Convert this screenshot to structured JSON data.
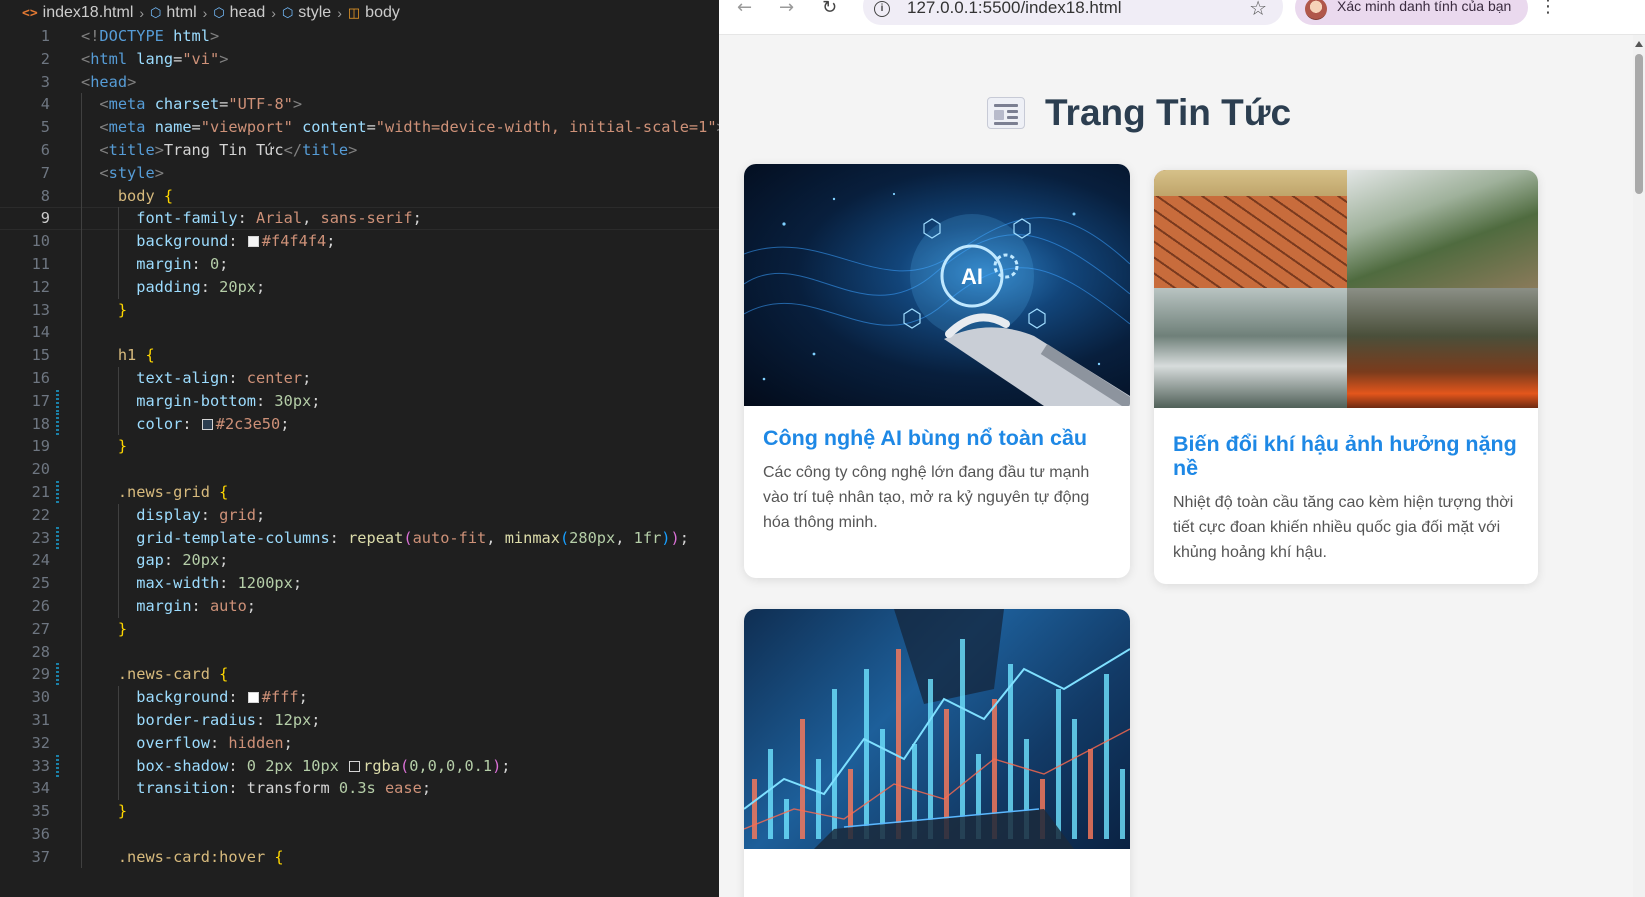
{
  "editor": {
    "breadcrumb": [
      "index18.html",
      "html",
      "head",
      "style",
      "body"
    ],
    "current_line": 9,
    "lines": [
      {
        "n": "1",
        "parts": [
          [
            "t-punc",
            "<!"
          ],
          [
            "t-tag",
            "DOCTYPE"
          ],
          [
            "t-plain",
            " "
          ],
          [
            "t-attr",
            "html"
          ],
          [
            "t-punc",
            ">"
          ]
        ]
      },
      {
        "n": "2",
        "parts": [
          [
            "t-punc",
            "<"
          ],
          [
            "t-tag",
            "html"
          ],
          [
            "t-plain",
            " "
          ],
          [
            "t-attr",
            "lang"
          ],
          [
            "t-plain",
            "="
          ],
          [
            "t-str",
            "\"vi\""
          ],
          [
            "t-punc",
            ">"
          ]
        ]
      },
      {
        "n": "3",
        "parts": [
          [
            "t-punc",
            "<"
          ],
          [
            "t-tag",
            "head"
          ],
          [
            "t-punc",
            ">"
          ]
        ]
      },
      {
        "n": "4",
        "parts": [
          [
            "t-plain",
            "  "
          ],
          [
            "t-punc",
            "<"
          ],
          [
            "t-tag",
            "meta"
          ],
          [
            "t-plain",
            " "
          ],
          [
            "t-attr",
            "charset"
          ],
          [
            "t-plain",
            "="
          ],
          [
            "t-str",
            "\"UTF-8\""
          ],
          [
            "t-punc",
            ">"
          ]
        ]
      },
      {
        "n": "5",
        "parts": [
          [
            "t-plain",
            "  "
          ],
          [
            "t-punc",
            "<"
          ],
          [
            "t-tag",
            "meta"
          ],
          [
            "t-plain",
            " "
          ],
          [
            "t-attr",
            "name"
          ],
          [
            "t-plain",
            "="
          ],
          [
            "t-str",
            "\"viewport\""
          ],
          [
            "t-plain",
            " "
          ],
          [
            "t-attr",
            "content"
          ],
          [
            "t-plain",
            "="
          ],
          [
            "t-str",
            "\"width=device-width, initial-scale=1\""
          ],
          [
            "t-punc",
            ">"
          ]
        ]
      },
      {
        "n": "6",
        "parts": [
          [
            "t-plain",
            "  "
          ],
          [
            "t-punc",
            "<"
          ],
          [
            "t-tag",
            "title"
          ],
          [
            "t-punc",
            ">"
          ],
          [
            "t-plain",
            "Trang Tin Tức"
          ],
          [
            "t-punc",
            "</"
          ],
          [
            "t-tag",
            "title"
          ],
          [
            "t-punc",
            ">"
          ]
        ]
      },
      {
        "n": "7",
        "parts": [
          [
            "t-plain",
            "  "
          ],
          [
            "t-punc",
            "<"
          ],
          [
            "t-tag",
            "style"
          ],
          [
            "t-punc",
            ">"
          ]
        ]
      },
      {
        "n": "8",
        "parts": [
          [
            "t-plain",
            "    "
          ],
          [
            "t-sel",
            "body"
          ],
          [
            "t-plain",
            " "
          ],
          [
            "t-br",
            "{"
          ]
        ]
      },
      {
        "n": "9",
        "parts": [
          [
            "t-plain",
            "      "
          ],
          [
            "t-prop",
            "font-family"
          ],
          [
            "t-plain",
            ": "
          ],
          [
            "t-kw",
            "Arial"
          ],
          [
            "t-plain",
            ", "
          ],
          [
            "t-kw",
            "sans-serif"
          ],
          [
            "t-plain",
            ";"
          ]
        ]
      },
      {
        "n": "10",
        "parts": [
          [
            "t-plain",
            "      "
          ],
          [
            "t-prop",
            "background"
          ],
          [
            "t-plain",
            ": "
          ],
          [
            "swatch",
            "#f4f4f4"
          ],
          [
            "t-kw",
            "#f4f4f4"
          ],
          [
            "t-plain",
            ";"
          ]
        ]
      },
      {
        "n": "11",
        "parts": [
          [
            "t-plain",
            "      "
          ],
          [
            "t-prop",
            "margin"
          ],
          [
            "t-plain",
            ": "
          ],
          [
            "t-num",
            "0"
          ],
          [
            "t-plain",
            ";"
          ]
        ]
      },
      {
        "n": "12",
        "parts": [
          [
            "t-plain",
            "      "
          ],
          [
            "t-prop",
            "padding"
          ],
          [
            "t-plain",
            ": "
          ],
          [
            "t-num",
            "20px"
          ],
          [
            "t-plain",
            ";"
          ]
        ]
      },
      {
        "n": "13",
        "parts": [
          [
            "t-plain",
            "    "
          ],
          [
            "t-br",
            "}"
          ]
        ]
      },
      {
        "n": "14",
        "parts": []
      },
      {
        "n": "15",
        "parts": [
          [
            "t-plain",
            "    "
          ],
          [
            "t-sel",
            "h1"
          ],
          [
            "t-plain",
            " "
          ],
          [
            "t-br",
            "{"
          ]
        ]
      },
      {
        "n": "16",
        "parts": [
          [
            "t-plain",
            "      "
          ],
          [
            "t-prop",
            "text-align"
          ],
          [
            "t-plain",
            ": "
          ],
          [
            "t-kw",
            "center"
          ],
          [
            "t-plain",
            ";"
          ]
        ]
      },
      {
        "n": "17",
        "parts": [
          [
            "t-plain",
            "      "
          ],
          [
            "t-prop",
            "margin-bottom"
          ],
          [
            "t-plain",
            ": "
          ],
          [
            "t-num",
            "30px"
          ],
          [
            "t-plain",
            ";"
          ]
        ]
      },
      {
        "n": "18",
        "parts": [
          [
            "t-plain",
            "      "
          ],
          [
            "t-prop",
            "color"
          ],
          [
            "t-plain",
            ": "
          ],
          [
            "swatch",
            "#2c3e50"
          ],
          [
            "t-kw",
            "#2c3e50"
          ],
          [
            "t-plain",
            ";"
          ]
        ]
      },
      {
        "n": "19",
        "parts": [
          [
            "t-plain",
            "    "
          ],
          [
            "t-br",
            "}"
          ]
        ]
      },
      {
        "n": "20",
        "parts": []
      },
      {
        "n": "21",
        "parts": [
          [
            "t-plain",
            "    "
          ],
          [
            "t-sel",
            ".news-grid"
          ],
          [
            "t-plain",
            " "
          ],
          [
            "t-br",
            "{"
          ]
        ]
      },
      {
        "n": "22",
        "parts": [
          [
            "t-plain",
            "      "
          ],
          [
            "t-prop",
            "display"
          ],
          [
            "t-plain",
            ": "
          ],
          [
            "t-kw",
            "grid"
          ],
          [
            "t-plain",
            ";"
          ]
        ]
      },
      {
        "n": "23",
        "parts": [
          [
            "t-plain",
            "      "
          ],
          [
            "t-prop",
            "grid-template-columns"
          ],
          [
            "t-plain",
            ": "
          ],
          [
            "t-fn",
            "repeat"
          ],
          [
            "t-br2",
            "("
          ],
          [
            "t-kw",
            "auto-fit"
          ],
          [
            "t-plain",
            ", "
          ],
          [
            "t-fn",
            "minmax"
          ],
          [
            "t-br3",
            "("
          ],
          [
            "t-num",
            "280px"
          ],
          [
            "t-plain",
            ", "
          ],
          [
            "t-num",
            "1fr"
          ],
          [
            "t-br3",
            ")"
          ],
          [
            "t-br2",
            ")"
          ],
          [
            "t-plain",
            ";"
          ]
        ]
      },
      {
        "n": "24",
        "parts": [
          [
            "t-plain",
            "      "
          ],
          [
            "t-prop",
            "gap"
          ],
          [
            "t-plain",
            ": "
          ],
          [
            "t-num",
            "20px"
          ],
          [
            "t-plain",
            ";"
          ]
        ]
      },
      {
        "n": "25",
        "parts": [
          [
            "t-plain",
            "      "
          ],
          [
            "t-prop",
            "max-width"
          ],
          [
            "t-plain",
            ": "
          ],
          [
            "t-num",
            "1200px"
          ],
          [
            "t-plain",
            ";"
          ]
        ]
      },
      {
        "n": "26",
        "parts": [
          [
            "t-plain",
            "      "
          ],
          [
            "t-prop",
            "margin"
          ],
          [
            "t-plain",
            ": "
          ],
          [
            "t-kw",
            "auto"
          ],
          [
            "t-plain",
            ";"
          ]
        ]
      },
      {
        "n": "27",
        "parts": [
          [
            "t-plain",
            "    "
          ],
          [
            "t-br",
            "}"
          ]
        ]
      },
      {
        "n": "28",
        "parts": []
      },
      {
        "n": "29",
        "parts": [
          [
            "t-plain",
            "    "
          ],
          [
            "t-sel",
            ".news-card"
          ],
          [
            "t-plain",
            " "
          ],
          [
            "t-br",
            "{"
          ]
        ]
      },
      {
        "n": "30",
        "parts": [
          [
            "t-plain",
            "      "
          ],
          [
            "t-prop",
            "background"
          ],
          [
            "t-plain",
            ": "
          ],
          [
            "swatch",
            "#ffffff"
          ],
          [
            "t-kw",
            "#fff"
          ],
          [
            "t-plain",
            ";"
          ]
        ]
      },
      {
        "n": "31",
        "parts": [
          [
            "t-plain",
            "      "
          ],
          [
            "t-prop",
            "border-radius"
          ],
          [
            "t-plain",
            ": "
          ],
          [
            "t-num",
            "12px"
          ],
          [
            "t-plain",
            ";"
          ]
        ]
      },
      {
        "n": "32",
        "parts": [
          [
            "t-plain",
            "      "
          ],
          [
            "t-prop",
            "overflow"
          ],
          [
            "t-plain",
            ": "
          ],
          [
            "t-kw",
            "hidden"
          ],
          [
            "t-plain",
            ";"
          ]
        ]
      },
      {
        "n": "33",
        "parts": [
          [
            "t-plain",
            "      "
          ],
          [
            "t-prop",
            "box-shadow"
          ],
          [
            "t-plain",
            ": "
          ],
          [
            "t-num",
            "0 2px 10px"
          ],
          [
            "t-plain",
            " "
          ],
          [
            "swatch",
            "#1f1f1f"
          ],
          [
            "t-fn",
            "rgba"
          ],
          [
            "t-br2",
            "("
          ],
          [
            "t-num",
            "0,0,0,0.1"
          ],
          [
            "t-br2",
            ")"
          ],
          [
            "t-plain",
            ";"
          ]
        ]
      },
      {
        "n": "34",
        "parts": [
          [
            "t-plain",
            "      "
          ],
          [
            "t-prop",
            "transition"
          ],
          [
            "t-plain",
            ": "
          ],
          [
            "t-plain",
            "transform "
          ],
          [
            "t-num",
            "0.3s"
          ],
          [
            "t-plain",
            " "
          ],
          [
            "t-kw",
            "ease"
          ],
          [
            "t-plain",
            ";"
          ]
        ]
      },
      {
        "n": "35",
        "parts": [
          [
            "t-plain",
            "    "
          ],
          [
            "t-br",
            "}"
          ]
        ]
      },
      {
        "n": "36",
        "parts": []
      },
      {
        "n": "37",
        "parts": [
          [
            "t-plain",
            "    "
          ],
          [
            "t-sel",
            ".news-card:hover"
          ],
          [
            "t-plain",
            " "
          ],
          [
            "t-br",
            "{"
          ]
        ]
      }
    ]
  },
  "browser": {
    "url": "127.0.0.1:5500/index18.html",
    "profile_label": "Xác minh danh tính của bạn",
    "page": {
      "title": "Trang Tin Tức",
      "cards": [
        {
          "headline": "Công nghệ AI bùng nổ toàn cầu",
          "summary": "Các công ty công nghệ lớn đang đầu tư mạnh vào trí tuệ nhân tạo, mở ra kỷ nguyên tự động hóa thông minh.",
          "image": "ai-robot-hand-image"
        },
        {
          "headline": "Biến đổi khí hậu ảnh hưởng nặng nề",
          "summary": "Nhiệt độ toàn cầu tăng cao kèm hiện tượng thời tiết cực đoan khiến nhiều quốc gia đối mặt với khủng hoảng khí hậu.",
          "image": "climate-disaster-collage-image"
        },
        {
          "headline": "",
          "summary": "",
          "image": "stock-market-chart-image"
        }
      ]
    }
  },
  "colors": {
    "heading": "#2c3e50",
    "link": "#1e88e5",
    "page_bg": "#f4f4f4",
    "editor_bg": "#1f1f1f"
  }
}
